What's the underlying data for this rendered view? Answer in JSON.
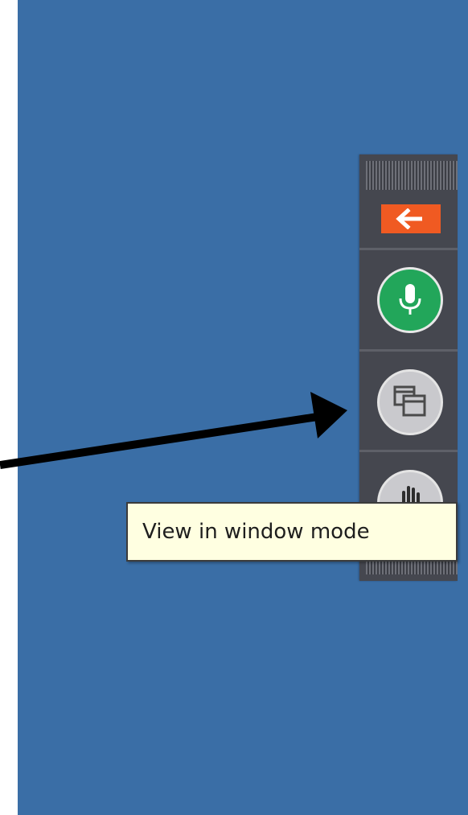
{
  "toolbar": {
    "back_icon": "arrow-left-icon",
    "mic_icon": "microphone-icon",
    "window_icon": "window-mode-icon",
    "hand_icon": "raise-hand-icon"
  },
  "tooltip": {
    "text": "View in window mode"
  },
  "colors": {
    "desktop": "#3a6ea6",
    "toolbar": "#45474f",
    "back_button": "#f05a22",
    "mic_button": "#22a65a",
    "tooltip_bg": "#ffffe1"
  }
}
